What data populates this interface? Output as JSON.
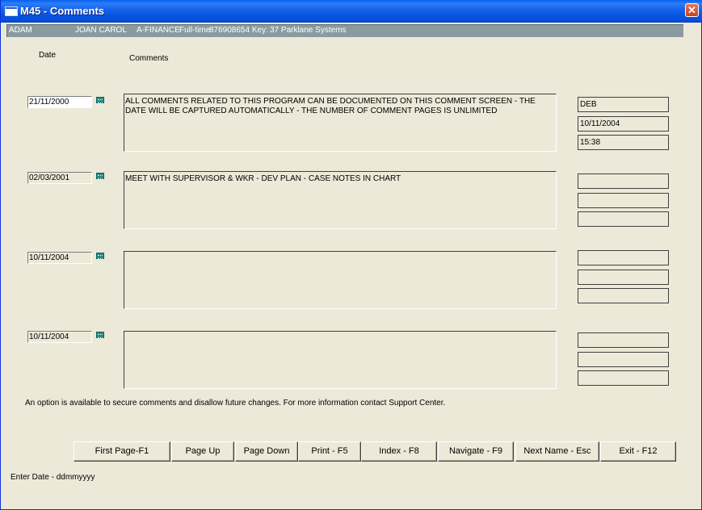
{
  "window": {
    "title": "M45 - Comments",
    "close": "✕"
  },
  "infobar": {
    "last_name": "ADAM",
    "first_name": "JOAN CAROL",
    "program": "A-FINANCE",
    "status": "Full-time",
    "id_key": "876908654 Key:",
    "company": "37 Parklane Systems"
  },
  "headers": {
    "date": "Date",
    "comments": "Comments"
  },
  "entries": [
    {
      "date": "21/11/2000",
      "comment": "ALL COMMENTS RELATED TO THIS PROGRAM CAN BE DOCUMENTED ON THIS  COMMENT SCREEN - THE DATE WILL BE CAPTURED AUTOMATICALLY - THE  NUMBER OF COMMENT PAGES IS UNLIMITED",
      "user": "DEB",
      "entered_date": "10/11/2004",
      "entered_time": "15:38"
    },
    {
      "date": "02/03/2001",
      "comment": "MEET WITH SUPERVISOR & WKR - DEV PLAN - CASE NOTES IN CHART",
      "user": "",
      "entered_date": "",
      "entered_time": ""
    },
    {
      "date": "10/11/2004",
      "comment": "",
      "user": "",
      "entered_date": "",
      "entered_time": ""
    },
    {
      "date": "10/11/2004",
      "comment": "",
      "user": "",
      "entered_date": "",
      "entered_time": ""
    }
  ],
  "notice": "An option is available to secure comments and disallow future changes. For more information contact Support Center.",
  "buttons": {
    "first_page": "First Page-F1",
    "page_up": "Page Up",
    "page_down": "Page Down",
    "print": "Print - F5",
    "index": "Index - F8",
    "navigate": "Navigate - F9",
    "next_name": "Next Name - Esc",
    "exit": "Exit - F12"
  },
  "status_bar": "Enter Date - ddmmyyyy"
}
